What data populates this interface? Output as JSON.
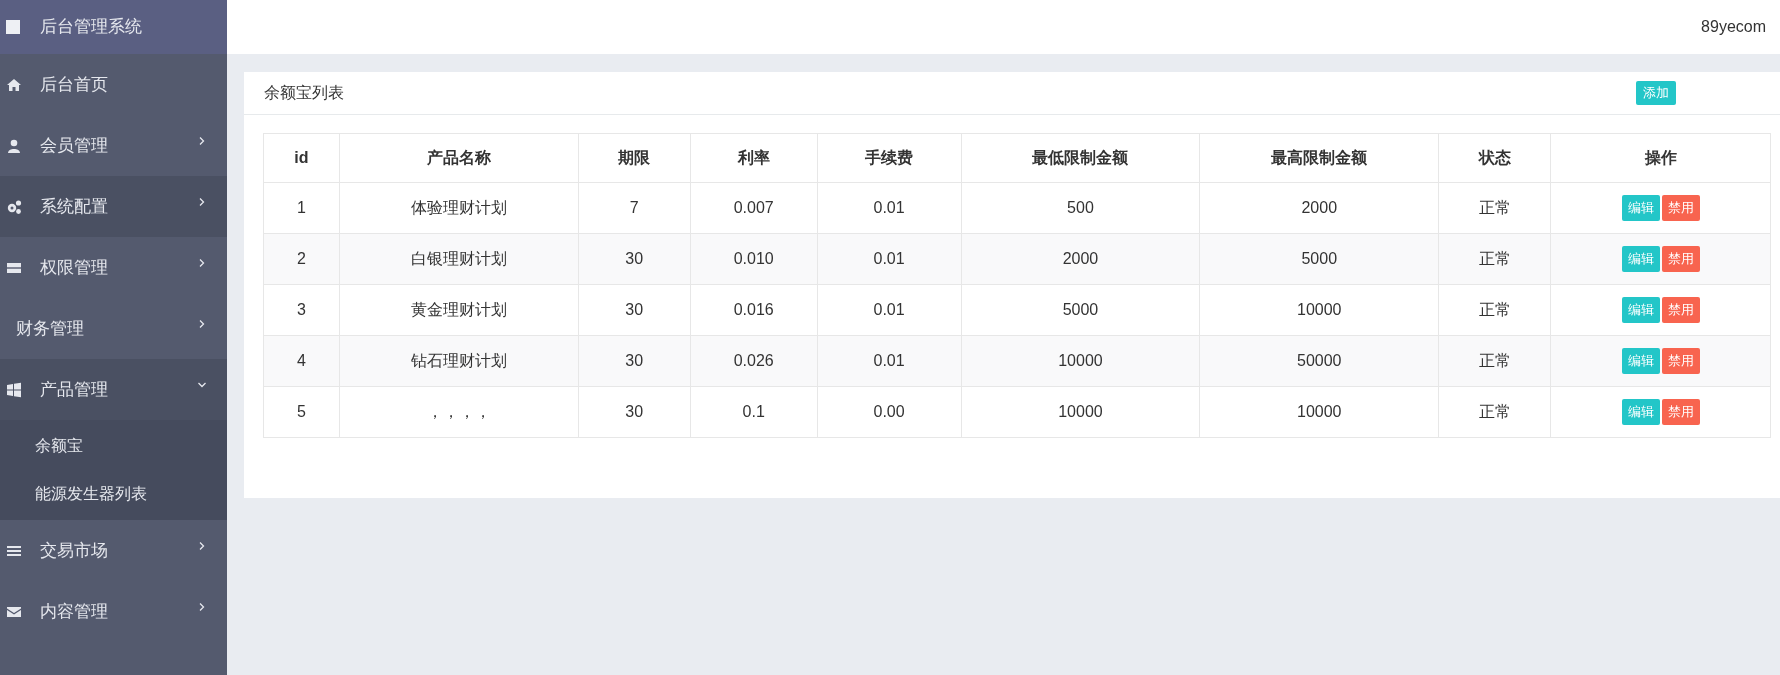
{
  "sidebar": {
    "brand": "后台管理系统",
    "items": [
      {
        "label": "后台首页",
        "highlighted": false
      },
      {
        "label": "会员管理",
        "expanded": false,
        "highlighted": false
      },
      {
        "label": "系统配置",
        "expanded": false,
        "highlighted": true
      },
      {
        "label": "权限管理",
        "expanded": false,
        "highlighted": false
      },
      {
        "label": "财务管理",
        "expanded": false,
        "highlighted": false
      },
      {
        "label": "产品管理",
        "expanded": true,
        "highlighted": true,
        "children": [
          {
            "label": "余额宝"
          },
          {
            "label": "能源发生器列表"
          }
        ]
      },
      {
        "label": "交易市场",
        "expanded": false,
        "highlighted": false
      },
      {
        "label": "内容管理",
        "expanded": false,
        "highlighted": false
      }
    ]
  },
  "header": {
    "user": "89yecom"
  },
  "panel": {
    "title": "余额宝列表",
    "add_button": "添加"
  },
  "table": {
    "columns": [
      "id",
      "产品名称",
      "期限",
      "利率",
      "手续费",
      "最低限制金额",
      "最高限制金额",
      "状态",
      "操作"
    ],
    "rows": [
      {
        "cells": [
          "1",
          "体验理财计划",
          "7",
          "0.007",
          "0.01",
          "500",
          "2000",
          "正常"
        ],
        "actions": [
          "编辑",
          "禁用"
        ]
      },
      {
        "cells": [
          "2",
          "白银理财计划",
          "30",
          "0.010",
          "0.01",
          "2000",
          "5000",
          "正常"
        ],
        "actions": [
          "编辑",
          "禁用"
        ]
      },
      {
        "cells": [
          "3",
          "黄金理财计划",
          "30",
          "0.016",
          "0.01",
          "5000",
          "10000",
          "正常"
        ],
        "actions": [
          "编辑",
          "禁用"
        ]
      },
      {
        "cells": [
          "4",
          "钻石理财计划",
          "30",
          "0.026",
          "0.01",
          "10000",
          "50000",
          "正常"
        ],
        "actions": [
          "编辑",
          "禁用"
        ]
      },
      {
        "cells": [
          "5",
          "，，，，",
          "30",
          "0.1",
          "0.00",
          "10000",
          "10000",
          "正常"
        ],
        "actions": [
          "编辑",
          "禁用"
        ]
      }
    ]
  }
}
